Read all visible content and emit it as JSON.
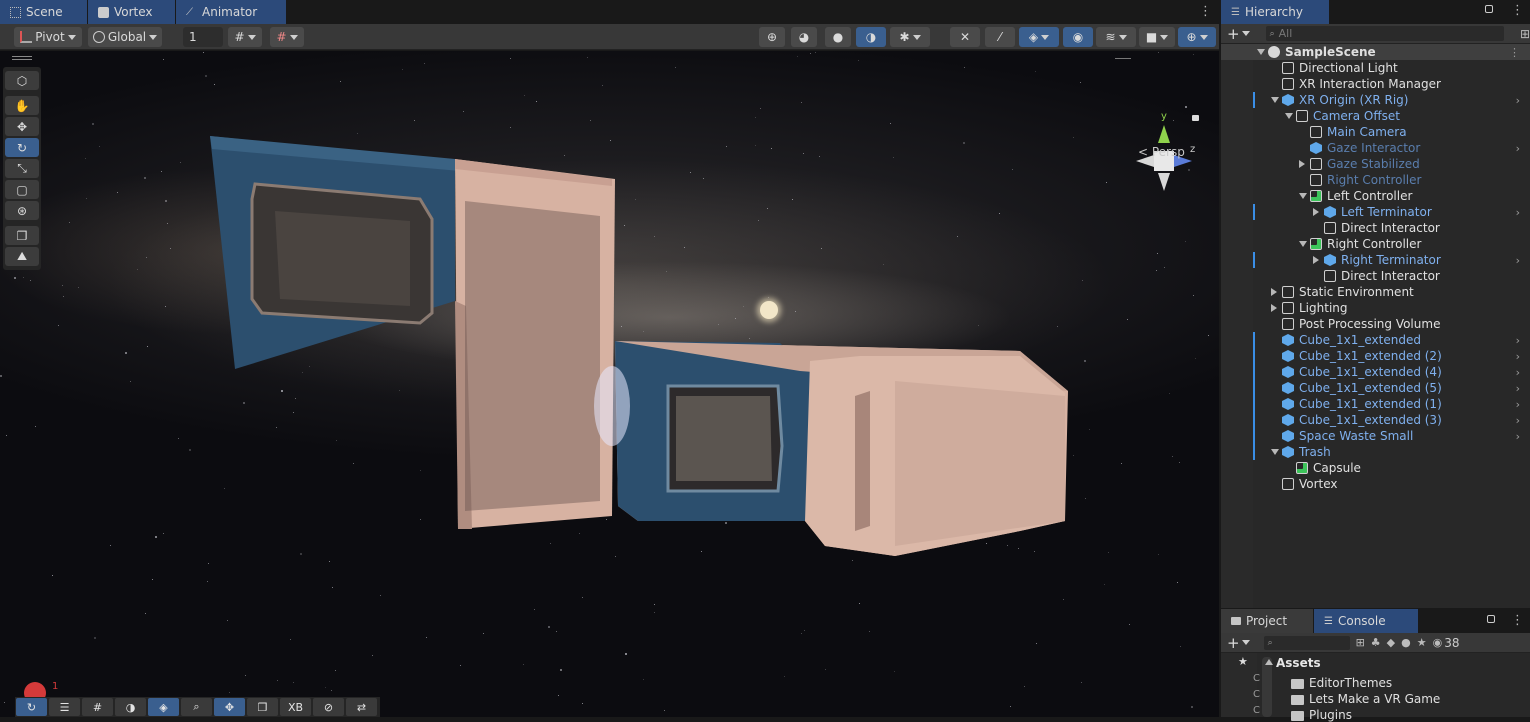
{
  "scene_tabs": [
    {
      "label": "Scene",
      "icon": "grid-icon"
    },
    {
      "label": "Vortex",
      "icon": "vortex-icon"
    },
    {
      "label": "Animator",
      "icon": "animator-icon"
    }
  ],
  "scene_toolbar": {
    "pivot_label": "Pivot",
    "global_label": "Global",
    "grid_snap_value": "1"
  },
  "viewport": {
    "projection_label": "< Persp",
    "gizmo_axes": {
      "y": "y",
      "z": "z"
    }
  },
  "console_badge": "1",
  "bottom_bar": {
    "xb_label": "XB"
  },
  "hierarchy": {
    "tab_label": "Hierarchy",
    "search_placeholder": "All",
    "items": [
      {
        "label": "SampleScene"
      },
      {
        "label": "Directional Light"
      },
      {
        "label": "XR Interaction Manager"
      },
      {
        "label": "XR Origin (XR Rig)"
      },
      {
        "label": "Camera Offset"
      },
      {
        "label": "Main Camera"
      },
      {
        "label": "Gaze Interactor"
      },
      {
        "label": "Gaze Stabilized"
      },
      {
        "label": "Right Controller"
      },
      {
        "label": "Left Controller"
      },
      {
        "label": "Left Terminator"
      },
      {
        "label": "Direct Interactor"
      },
      {
        "label": "Right Controller"
      },
      {
        "label": "Right Terminator"
      },
      {
        "label": "Direct Interactor"
      },
      {
        "label": "Static Environment"
      },
      {
        "label": "Lighting"
      },
      {
        "label": "Post Processing Volume"
      },
      {
        "label": "Cube_1x1_extended"
      },
      {
        "label": "Cube_1x1_extended (2)"
      },
      {
        "label": "Cube_1x1_extended (4)"
      },
      {
        "label": "Cube_1x1_extended (5)"
      },
      {
        "label": "Cube_1x1_extended (1)"
      },
      {
        "label": "Cube_1x1_extended (3)"
      },
      {
        "label": "Space Waste Small"
      },
      {
        "label": "Trash"
      },
      {
        "label": "Capsule"
      },
      {
        "label": "Vortex"
      }
    ]
  },
  "project": {
    "tabs": [
      {
        "label": "Project"
      },
      {
        "label": "Console"
      }
    ],
    "hidden_count": "38",
    "root_label": "Assets",
    "folders": [
      {
        "label": "EditorThemes"
      },
      {
        "label": "Lets Make a VR Game"
      },
      {
        "label": "Plugins"
      }
    ]
  },
  "colors": {
    "accent": "#3a5f8f",
    "prefab_blue": "#7fb0ee",
    "ship_hull": "#d9b3a4",
    "ship_panel": "#2c4f6e"
  }
}
